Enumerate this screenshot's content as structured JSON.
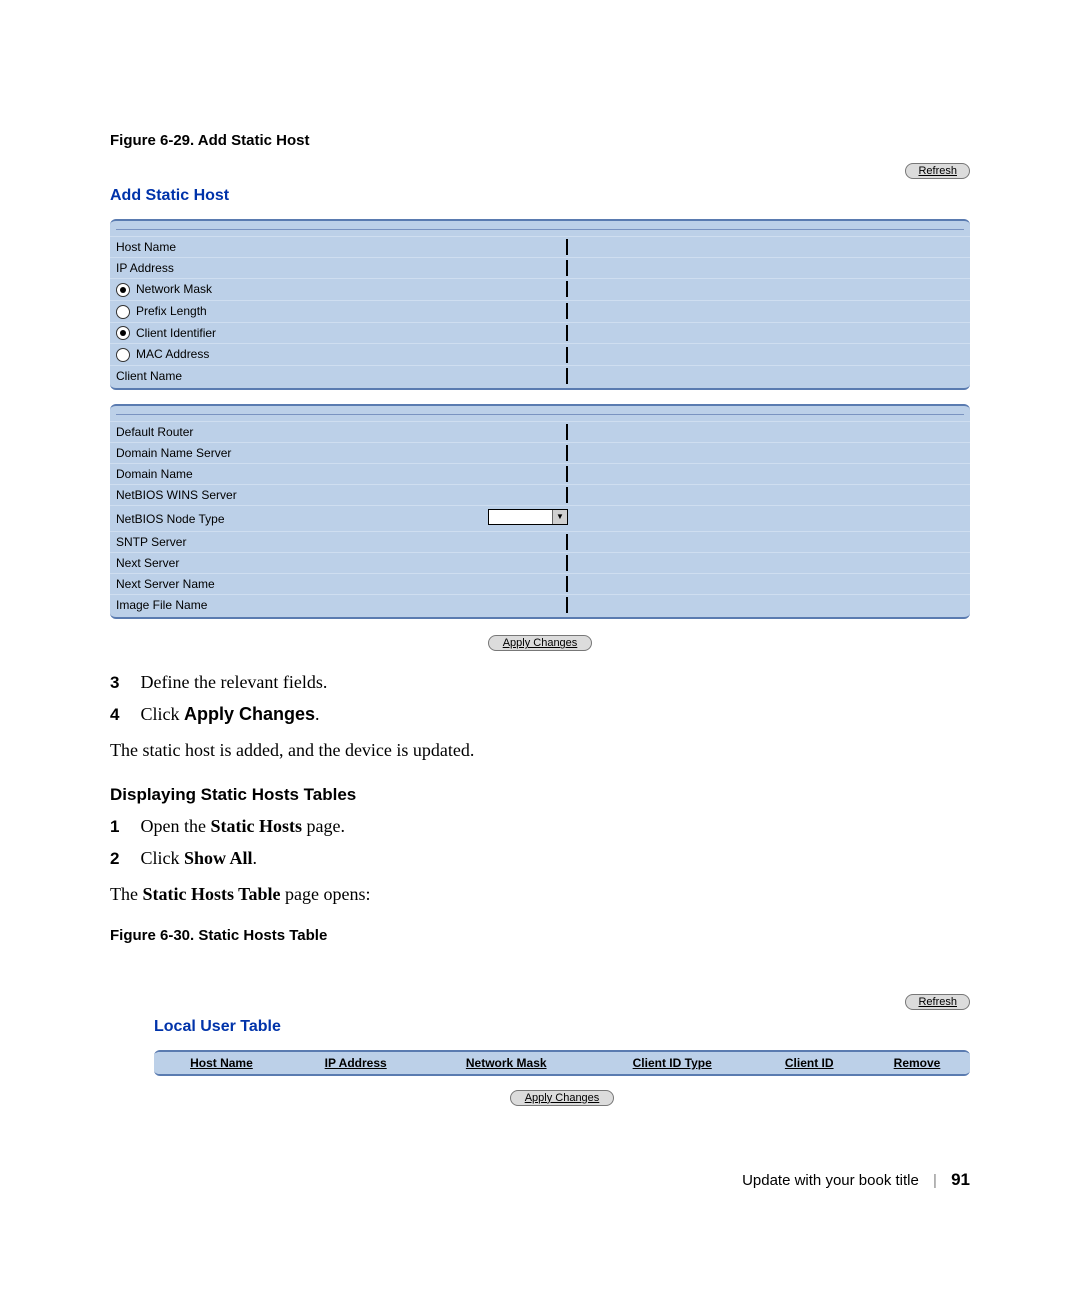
{
  "captions": {
    "fig1": "Figure 6-29.    Add Static Host",
    "fig2": "Figure 6-30.    Static Hosts Table"
  },
  "buttons": {
    "refresh": "Refresh",
    "apply_changes": "Apply Changes"
  },
  "panel1": {
    "title": "Add Static Host",
    "rows": [
      {
        "label": "Host Name",
        "type": "text",
        "disabled": false
      },
      {
        "label": "IP Address",
        "type": "text",
        "disabled": false,
        "indent": true
      },
      {
        "label": "Network Mask",
        "type": "radio",
        "checked": true,
        "indent": true,
        "input_disabled": false
      },
      {
        "label": "Prefix Length",
        "type": "radio",
        "checked": false,
        "indent": true,
        "input_disabled": true
      },
      {
        "label": "Client Identifier",
        "type": "radio",
        "checked": true,
        "indent": true,
        "input_disabled": false
      },
      {
        "label": "MAC Address",
        "type": "radio",
        "checked": false,
        "indent": true,
        "input_disabled": true
      },
      {
        "label": "Client Name",
        "type": "text",
        "disabled": false
      }
    ]
  },
  "panel2": {
    "rows": [
      {
        "label": "Default Router",
        "type": "text"
      },
      {
        "label": "Domain Name Server",
        "type": "text"
      },
      {
        "label": "Domain Name",
        "type": "text"
      },
      {
        "label": "NetBIOS WINS Server",
        "type": "text"
      },
      {
        "label": "NetBIOS Node Type",
        "type": "select"
      },
      {
        "label": "SNTP Server",
        "type": "text"
      },
      {
        "label": "Next Server",
        "type": "text"
      },
      {
        "label": "Next Server Name",
        "type": "text"
      },
      {
        "label": "Image File Name",
        "type": "text"
      }
    ]
  },
  "steps_a": {
    "s3_num": "3",
    "s3_text": "Define the relevant fields.",
    "s4_num": "4",
    "s4_pre": "Click ",
    "s4_bold": "Apply Changes",
    "s4_post": "."
  },
  "result_a": "The static host is added, and the device is updated.",
  "section_heading": "Displaying Static Hosts Tables",
  "steps_b": {
    "s1_num": "1",
    "s1_pre": "Open the ",
    "s1_bold": "Static Hosts",
    "s1_post": " page.",
    "s2_num": "2",
    "s2_pre": "Click ",
    "s2_bold": "Show All",
    "s2_post": "."
  },
  "result_b_pre": "The ",
  "result_b_bold": "Static Hosts Table",
  "result_b_post": " page opens:",
  "panel3": {
    "title": "Local User Table",
    "cols": [
      "Host Name",
      "IP Address",
      "Network Mask",
      "Client ID Type",
      "Client ID",
      "Remove"
    ]
  },
  "footer": {
    "title": "Update with your book title",
    "page": "91"
  }
}
